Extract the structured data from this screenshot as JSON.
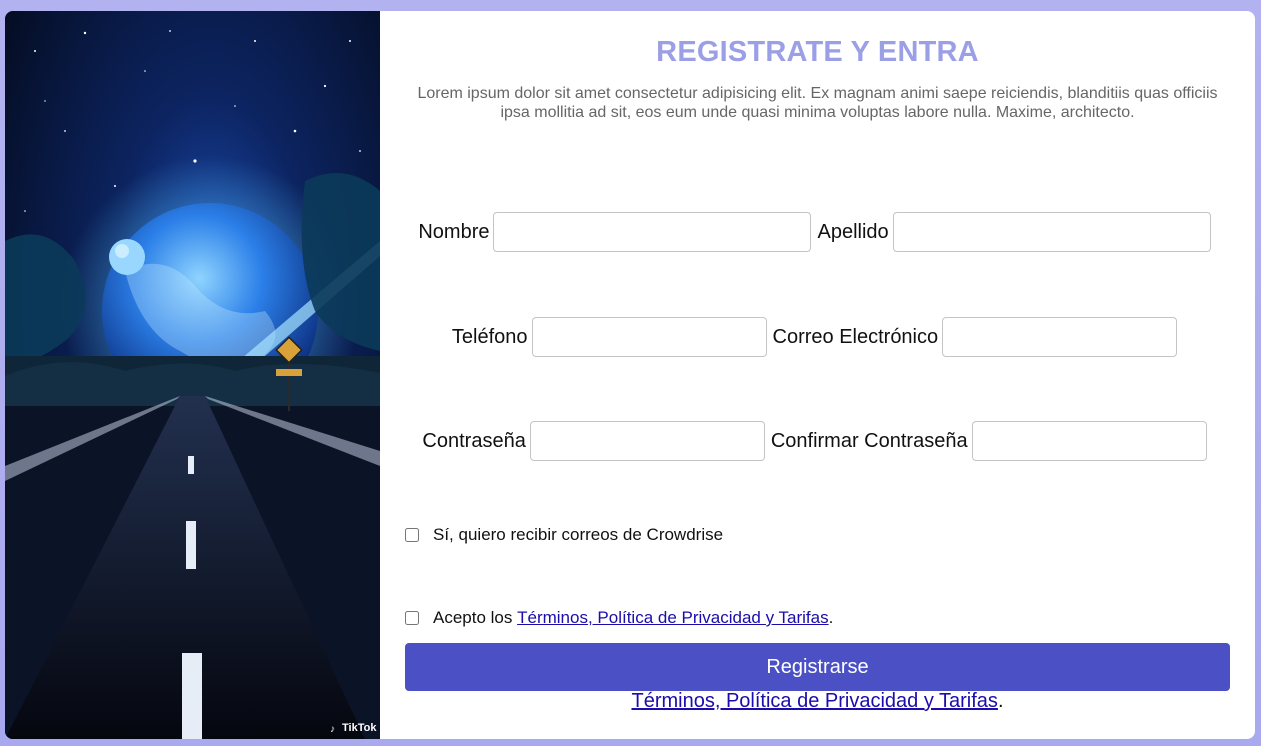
{
  "hero": {
    "watermark": "TikTok",
    "image_description_icon": "night-road-planet-image"
  },
  "form": {
    "title": "REGISTRATE Y ENTRA",
    "description": "Lorem ipsum dolor sit amet consectetur adipisicing elit. Ex magnam animi saepe reiciendis, blanditiis quas officiis ipsa mollitia ad sit, eos eum unde quasi minima voluptas labore nulla. Maxime, architecto.",
    "fields": {
      "nombre": {
        "label": "Nombre",
        "value": ""
      },
      "apellido": {
        "label": "Apellido",
        "value": ""
      },
      "telefono": {
        "label": "Teléfono",
        "value": ""
      },
      "correo": {
        "label": "Correo Electrónico",
        "value": ""
      },
      "contrasena": {
        "label": "Contraseña",
        "value": ""
      },
      "confirmar": {
        "label": "Confirmar Contraseña",
        "value": ""
      }
    },
    "newsletter": {
      "label": "Sí, quiero recibir correos de Crowdrise",
      "checked": false
    },
    "terms": {
      "prefix": "Acepto los ",
      "link": "Términos, Política de Privacidad y Tarifas",
      "suffix": ".",
      "checked": false
    },
    "submit_label": "Registrarse",
    "footer": {
      "link": "Términos, Política de Privacidad y Tarifas",
      "suffix": "."
    }
  },
  "colors": {
    "accent": "#4b51c4",
    "title": "#9b9fe6",
    "background": "#b3b2f0",
    "link": "#1a0dab"
  }
}
